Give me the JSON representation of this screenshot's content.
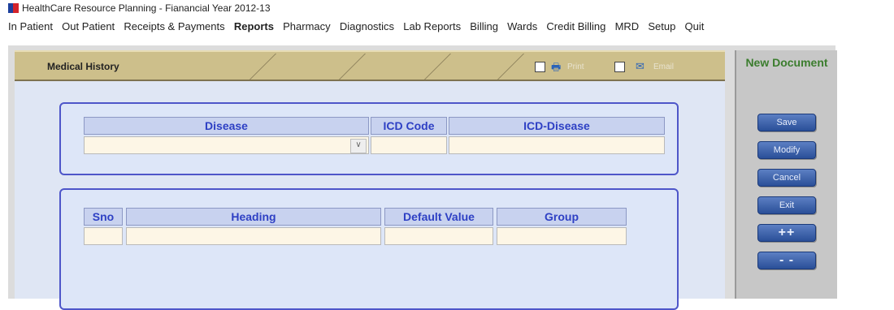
{
  "window": {
    "title": "HealthCare Resource Planning - Fianancial Year 2012-13"
  },
  "menu": [
    {
      "label": "In Patient"
    },
    {
      "label": "Out Patient"
    },
    {
      "label": "Receipts & Payments"
    },
    {
      "label": "Reports"
    },
    {
      "label": "Pharmacy"
    },
    {
      "label": "Diagnostics"
    },
    {
      "label": "Lab Reports"
    },
    {
      "label": "Billing"
    },
    {
      "label": "Wards"
    },
    {
      "label": "Credit Billing"
    },
    {
      "label": "MRD"
    },
    {
      "label": "Setup"
    },
    {
      "label": "Quit"
    }
  ],
  "header": {
    "title": "Medical History",
    "print_label": "Print",
    "email_label": "Email"
  },
  "disease_panel": {
    "columns": {
      "disease": "Disease",
      "icd_code": "ICD Code",
      "icd_disease": "ICD-Disease"
    },
    "values": {
      "disease": "",
      "icd_code": "",
      "icd_disease": ""
    }
  },
  "detail_panel": {
    "columns": {
      "sno": "Sno",
      "heading": "Heading",
      "default_value": "Default Value",
      "group": "Group"
    }
  },
  "actions": {
    "status": "New Document",
    "save": "Save",
    "modify": "Modify",
    "cancel": "Cancel",
    "exit": "Exit",
    "add_row": "++",
    "remove_row": "- -"
  },
  "colors": {
    "header_bar": "#cdbf8b",
    "panel_border": "#4e56c9",
    "column_text": "#2e40c4",
    "button_blue": "#2a4f98",
    "status_green": "#3b7d2e"
  }
}
